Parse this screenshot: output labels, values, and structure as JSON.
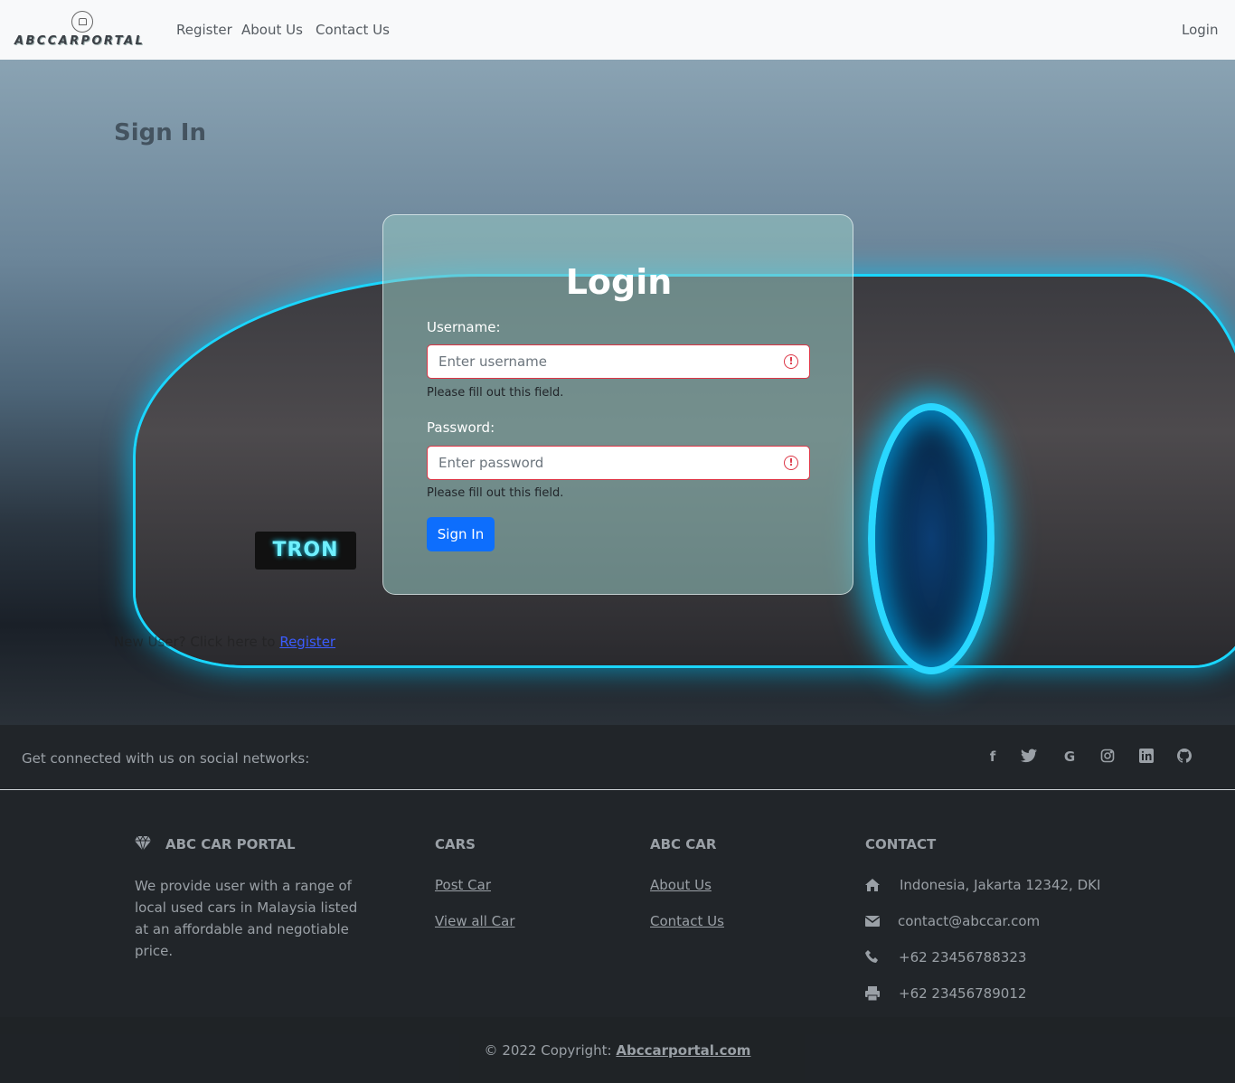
{
  "navbar": {
    "brand": "ABCCARPORTAL",
    "links": [
      "Register",
      "About Us",
      "Contact Us"
    ],
    "login": "Login"
  },
  "hero": {
    "ghost_title": "Sign In",
    "ghost_register_prefix": "New User? Click here to",
    "ghost_register_link": "Register",
    "plate_text": "TRON"
  },
  "login_form": {
    "title": "Login",
    "username_label": "Username:",
    "username_placeholder": "Enter username",
    "username_hint": "Please fill out this field.",
    "password_label": "Password:",
    "password_placeholder": "Enter password",
    "password_hint": "Please fill out this field.",
    "submit_label": "Sign In"
  },
  "social": {
    "text": "Get connected with us on social networks:",
    "icons": [
      "facebook-icon",
      "twitter-icon",
      "google-icon",
      "instagram-icon",
      "linkedin-icon",
      "github-icon"
    ]
  },
  "footer": {
    "brand_title": "ABC CAR PORTAL",
    "brand_text": "We provide user with a range of local used cars in Malaysia listed at an affordable and negotiable price.",
    "cars_title": "CARS",
    "cars_links": [
      "Post Car",
      "View all Car"
    ],
    "abc_title": "ABC CAR",
    "abc_links": [
      "About Us",
      "Contact Us"
    ],
    "contact_title": "CONTACT",
    "contact_address": "Indonesia, Jakarta 12342, DKI",
    "contact_email": "contact@abccar.com",
    "contact_phone": "+62 23456788323",
    "contact_fax": "+62 23456789012",
    "copyright_prefix": "© 2022 Copyright:",
    "copyright_link": "Abccarportal.com"
  },
  "colors": {
    "primary": "#0d6efd",
    "danger": "#dc3545",
    "footer_bg": "#212529",
    "navbar_bg": "#f8f9fa"
  }
}
